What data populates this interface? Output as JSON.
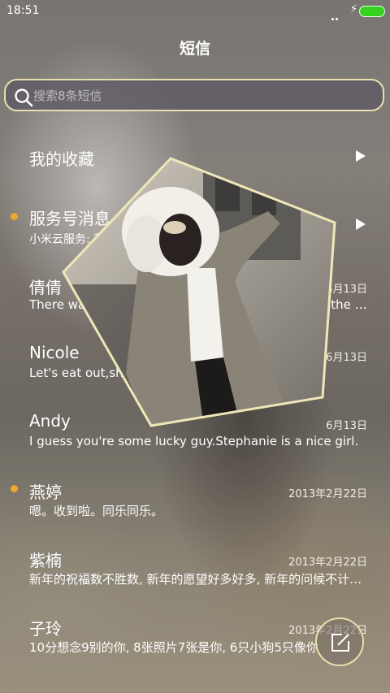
{
  "status": {
    "time": "18:51"
  },
  "header": {
    "title": "短信"
  },
  "search": {
    "placeholder": "搜索8条短信"
  },
  "favorites": {
    "label": "我的收藏"
  },
  "service": {
    "name": "服务号消息",
    "preview": "小米云服务: 我想送你一个小米MIX, 点击免费抽!"
  },
  "conversations": [
    {
      "name": "倩倩",
      "date": "6月13日",
      "preview": "There was a table set out under a tree in front of the house, and..."
    },
    {
      "name": "Nicole",
      "date": "6月13日",
      "preview": "Let's eat out,shall we?"
    },
    {
      "name": "Andy",
      "date": "6月13日",
      "preview": "I guess you're some lucky guy.Stephanie is a nice girl."
    },
    {
      "name": "燕婷",
      "date": "2013年2月22日",
      "preview": "嗯。收到啦。同乐同乐。"
    },
    {
      "name": "紫楠",
      "date": "2013年2月22日",
      "preview": "新年的祝福数不胜数, 新年的愿望好多好多, 新年的问候不计其数"
    },
    {
      "name": "子玲",
      "date": "2013年2月22日",
      "preview": "10分想念9别的你, 8张照片7张是你, 6只小狗5只像你"
    }
  ],
  "colors": {
    "accent": "#e8dfae",
    "unread_dot": "#f2a52a",
    "battery": "#34d21f"
  },
  "icons": {
    "search": "search-icon",
    "compose": "compose-icon",
    "arrow": "play-arrow-icon"
  }
}
